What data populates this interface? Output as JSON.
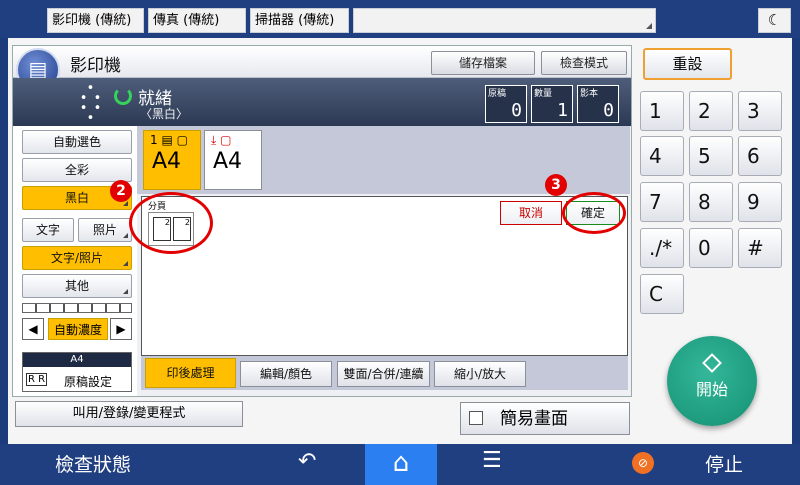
{
  "topbar": {
    "tabs": [
      "影印機 (傳統)",
      "傳真 (傳統)",
      "掃描器 (傳統)",
      ""
    ],
    "night_icon": "moon-icon"
  },
  "header": {
    "title": "影印機",
    "save_file_label": "儲存檔案",
    "check_mode_label": "檢查模式"
  },
  "status": {
    "ready": "就緒",
    "mode": "〈黑白〉",
    "counters": [
      {
        "label": "原稿",
        "value": "0"
      },
      {
        "label": "數量",
        "value": "1"
      },
      {
        "label": "影本",
        "value": "0"
      }
    ]
  },
  "left_menu": {
    "auto_color": "自動選色",
    "full_color": "全彩",
    "black_white": "黑白",
    "text": "文字",
    "photo": "照片",
    "text_photo": "文字/照片",
    "other": "其他",
    "auto_density": "自動濃度",
    "orig_size": "A4",
    "orig_icons": "R R",
    "orig_settings": "原稿設定"
  },
  "trays": [
    {
      "top": "1 ▤ ▢",
      "size": "A4",
      "selected": true
    },
    {
      "top": "⤓ ▢",
      "size": "A4",
      "selected": false
    }
  ],
  "finishing": {
    "sort_label": "分頁",
    "cancel_label": "取消",
    "ok_label": "確定",
    "step2": "2",
    "step3": "3"
  },
  "tabs": [
    "印後處理",
    "編輯/顏色",
    "雙面/合併/連續",
    "縮小/放大"
  ],
  "recall_label": "叫用/登錄/變更程式",
  "simple_screen_label": "簡易畫面",
  "keypad": {
    "reset_label": "重設",
    "keys": [
      "1",
      "2",
      "3",
      "4",
      "5",
      "6",
      "7",
      "8",
      "9",
      "./*",
      "0",
      "#",
      "C"
    ],
    "start_label": "開始"
  },
  "bottombar": {
    "check_status": "檢查狀態",
    "stop_label": "停止"
  },
  "colors": {
    "selected": "#ffbe00",
    "start": "#1a9a7a",
    "annotation": "#e20000"
  }
}
